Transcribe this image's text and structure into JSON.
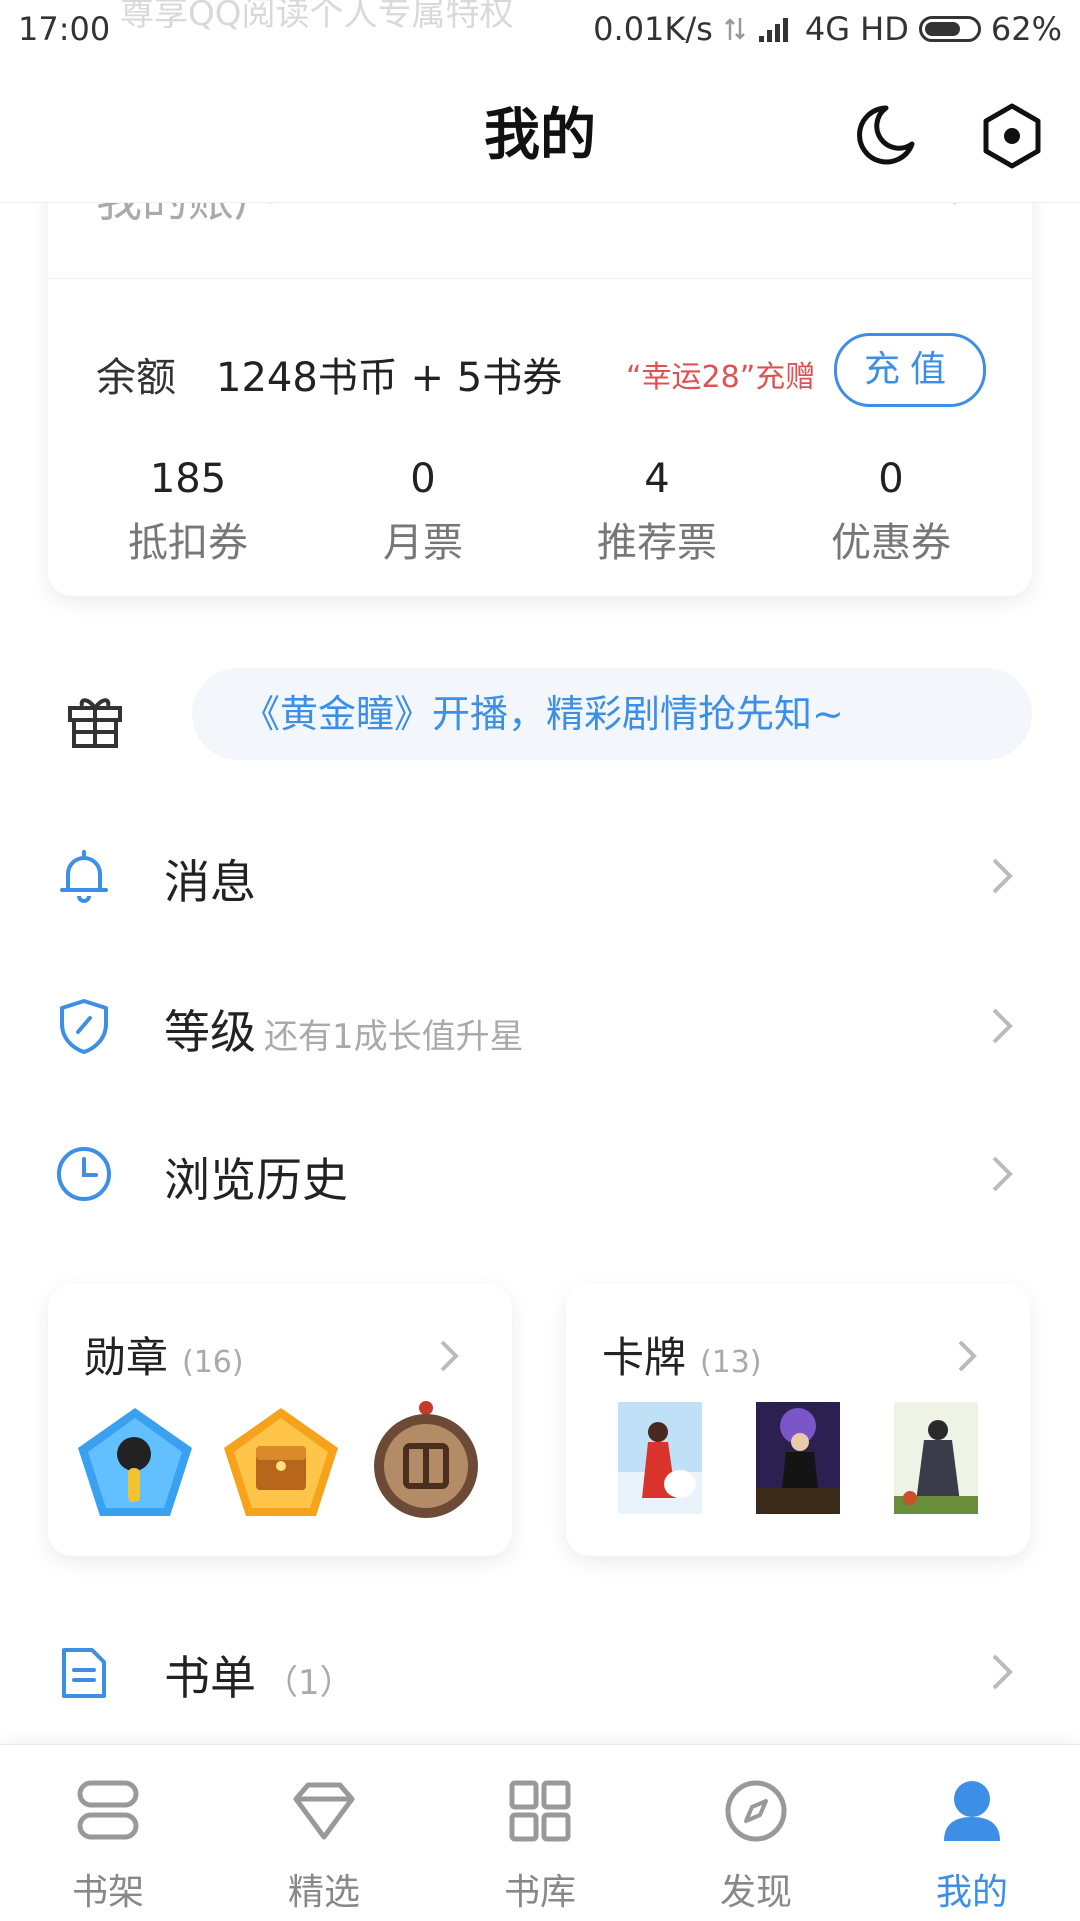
{
  "status_bar": {
    "time": "17:00",
    "ghost_text": "尊享QQ阅读个人专属特权",
    "net_speed": "0.01K/s",
    "network": "4G HD",
    "battery": "62%"
  },
  "header": {
    "title": "我的"
  },
  "account": {
    "ghost_title": "我的账户",
    "balance_label": "余额",
    "balance_value": "1248书币 + 5书券",
    "promo_text": "“幸运28”充赠",
    "recharge_label": "充值",
    "stats": [
      {
        "value": "185",
        "label": "抵扣券"
      },
      {
        "value": "0",
        "label": "月票"
      },
      {
        "value": "4",
        "label": "推荐票"
      },
      {
        "value": "0",
        "label": "优惠券"
      }
    ]
  },
  "notice": {
    "text": "《黄金瞳》开播，精彩剧情抢先知~"
  },
  "menu": {
    "messages": {
      "label": "消息"
    },
    "level": {
      "label": "等级",
      "sub": "还有1成长值升星"
    },
    "history": {
      "label": "浏览历史"
    },
    "booklist": {
      "label": "书单",
      "count": "（1）"
    }
  },
  "medals": {
    "title": "勋章",
    "count": "(16)"
  },
  "cards": {
    "title": "卡牌",
    "count": "(13)"
  },
  "colors": {
    "accent": "#3d8fe6",
    "promo": "#e05252"
  },
  "nav": [
    {
      "label": "书架",
      "icon": "bookshelf-icon",
      "active": false
    },
    {
      "label": "精选",
      "icon": "diamond-icon",
      "active": false
    },
    {
      "label": "书库",
      "icon": "grid-icon",
      "active": false
    },
    {
      "label": "发现",
      "icon": "compass-icon",
      "active": false
    },
    {
      "label": "我的",
      "icon": "user-icon",
      "active": true
    }
  ]
}
